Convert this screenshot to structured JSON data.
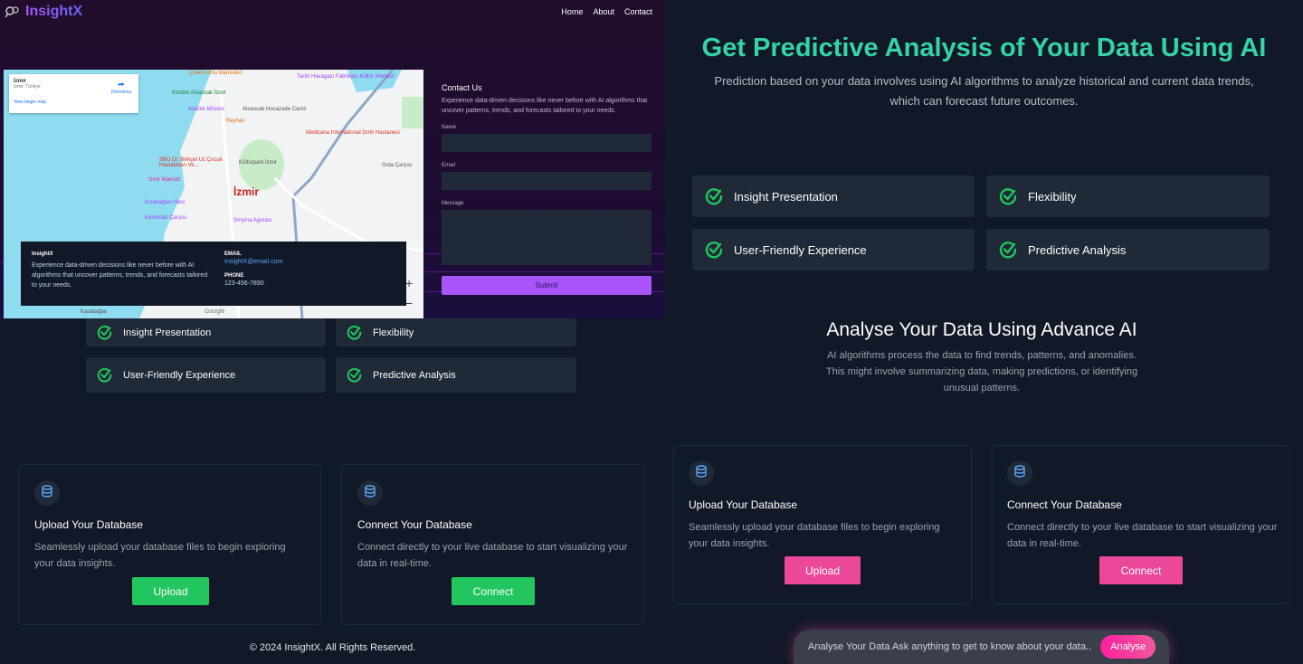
{
  "left": {
    "brand": "InsightX",
    "nav": [
      "Home",
      "About",
      "Contact"
    ],
    "map": {
      "place_name": "İzmir",
      "place_sub": "İzmir, Türkiye",
      "directions": "Directions",
      "larger_map": "View larger map",
      "city_label": "İzmir",
      "labels": [
        "Çelebi Unlu Mamulleri",
        "Tarihi Havagazı Fabrikası Kültür Merkezi",
        "Kordon Alsancak İzmir",
        "Atatürk Müzesi",
        "Alsancak Hocazade Camii",
        "Reyhan",
        "Medicana International İzmir Hastanesi",
        "Kültürpark İzmir",
        "SBÜ Dr. Behçet Uz Çocuk Hastalıkları Ve...",
        "Gıda Çarşısı",
        "İzmir Marriott",
        "Kızlarağası Hanı",
        "Kemeraltı Çarşısı",
        "Smyrna Agorası",
        "Karabağlar"
      ],
      "zoom_in": "+",
      "zoom_out": "−",
      "google": "Google"
    },
    "info": {
      "title": "InsightX",
      "desc": "Experience data-driven decisions like never before with AI algorithms that uncover patterns, trends, and forecasts tailored to your needs.",
      "email_label": "EMAIL",
      "email": "InsightX@email.com",
      "phone_label": "PHONE",
      "phone": "123-456-7890"
    },
    "contact": {
      "title": "Contact Us",
      "desc": "Experience data-driven decisions like never before with AI algorithms that uncover patterns, trends, and forecasts tailored to your needs.",
      "name_label": "Name",
      "email_label": "Email",
      "message_label": "Message",
      "submit": "Submit"
    },
    "features": [
      "Insight Presentation",
      "Flexibility",
      "User-Friendly Experience",
      "Predictive Analysis"
    ],
    "cards": [
      {
        "title": "Upload Your Database",
        "desc": "Seamlessly upload your database files to begin exploring your data insights.",
        "button": "Upload"
      },
      {
        "title": "Connect Your Database",
        "desc": "Connect directly to your live database to start visualizing your data in real-time.",
        "button": "Connect"
      }
    ],
    "footer": "© 2024 InsightX. All Rights Reserved.",
    "button_color": "#22c55e"
  },
  "right": {
    "title": "Get Predictive Analysis of Your Data Using AI",
    "subtitle": "Prediction based on your data involves using AI algorithms to analyze historical and current data trends, which can forecast future outcomes.",
    "features": [
      "Insight Presentation",
      "Flexibility",
      "User-Friendly Experience",
      "Predictive Analysis"
    ],
    "section_title": "Analyse Your Data Using Advance AI",
    "section_desc": "AI algorithms process the data to find trends, patterns, and anomalies. This might involve summarizing data, making predictions, or identifying unusual patterns.",
    "cards": [
      {
        "title": "Upload Your Database",
        "desc": "Seamlessly upload your database files to begin exploring your data insights.",
        "button": "Upload"
      },
      {
        "title": "Connect Your Database",
        "desc": "Connect directly to your live database to start visualizing your data in real-time.",
        "button": "Connect"
      }
    ],
    "analyse_placeholder": "Analyse Your Data Ask anything to get to know about your data..",
    "analyse_button": "Analyse",
    "title_color": "#34d3a9",
    "button_color": "#ec4899"
  }
}
